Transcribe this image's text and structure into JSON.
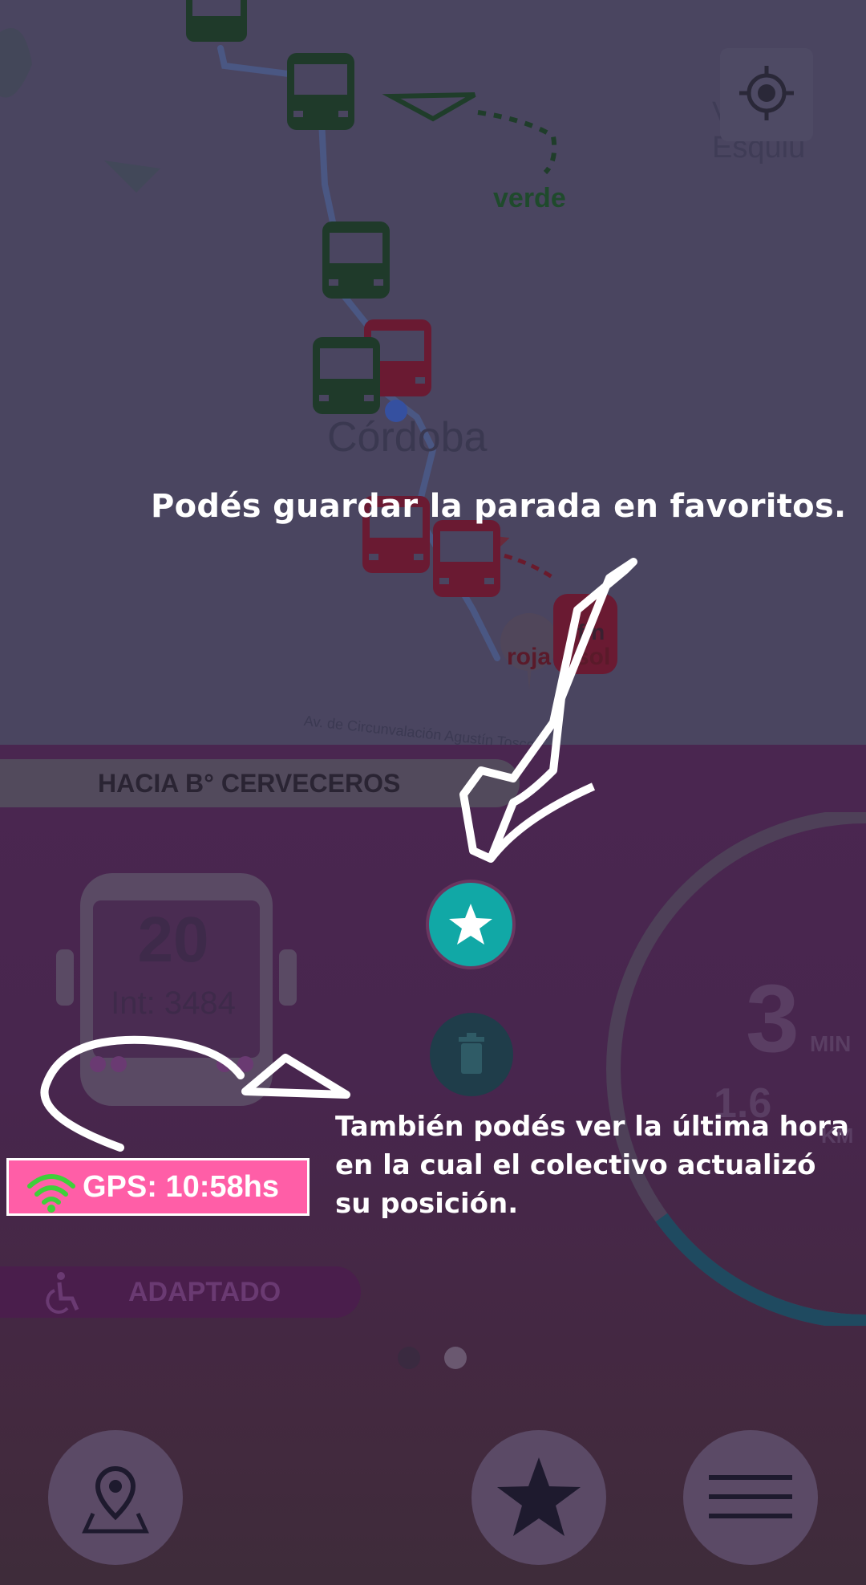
{
  "map": {
    "city_label": "Córdoba",
    "town_label": "Villa Esquiú",
    "route_label": "verde",
    "street_label": "Av. de Circunvalación Agustín Tosco",
    "stop_labels": [
      "fin",
      "roja",
      "sol"
    ],
    "locate_button": "crosshair-icon"
  },
  "panel": {
    "direction": "HACIA B° CERVECEROS",
    "bus": {
      "line": "20",
      "internal": "Int: 3484"
    },
    "eta": {
      "minutes": "3",
      "minutes_unit": "MIN",
      "distance": "1.6",
      "distance_unit": "KM"
    },
    "favorite_button": "star-icon",
    "delete_button": "trash-icon",
    "gps": {
      "label": "GPS: 10:58hs",
      "icon": "wifi-signal-icon"
    },
    "accessibility": {
      "label": "ADAPTADO",
      "icon": "wheelchair-icon"
    },
    "pager": {
      "count": 2,
      "active_index": 1
    }
  },
  "bottom_nav": [
    {
      "name": "map-nav-button",
      "icon": "map-pin-icon"
    },
    {
      "name": "favorites-nav-button",
      "icon": "star-icon"
    },
    {
      "name": "menu-nav-button",
      "icon": "hamburger-menu-icon"
    }
  ],
  "tutorial": {
    "tip_favorites": "Podés guardar la parada en favoritos.",
    "tip_gps_line1": "También podés ver la última hora",
    "tip_gps_line2": "en la cual el colectivo actualizó",
    "tip_gps_line3": "su posición."
  },
  "colors": {
    "accent_teal": "#11a8a6",
    "gps_badge": "#ff5ea7",
    "route_green": "#1f4a2c",
    "route_red": "#7a1a30",
    "overlay": "#3a2a44"
  }
}
